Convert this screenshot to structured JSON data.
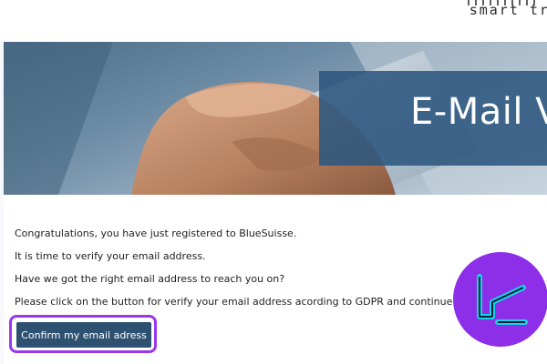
{
  "header": {
    "logo_text": "smart tra"
  },
  "hero": {
    "title": "E-Mail Ve"
  },
  "message": {
    "lines": [
      "Congratulations, you have just registered to BlueSuisse.",
      "It is time to verify your email address.",
      "Have we got the right email address to reach you on?",
      "Please click on the button for verify your email address acording to GDPR and continue the registratio"
    ]
  },
  "actions": {
    "confirm_label": "Confirm my email adress"
  },
  "colors": {
    "button": "#2f5171",
    "highlight": "#9b38e8",
    "banner": "#2c567e"
  },
  "icons": {
    "watermark": "tc-logo-icon"
  }
}
